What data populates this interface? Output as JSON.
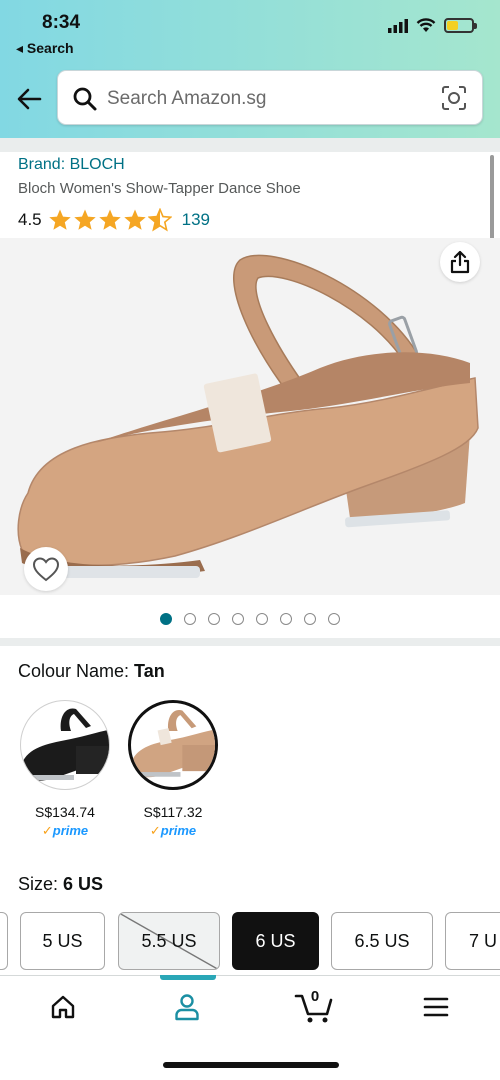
{
  "status_bar": {
    "time": "8:34",
    "back_label": "◂ Search"
  },
  "search": {
    "placeholder": "Search Amazon.sg"
  },
  "product": {
    "brand": "Brand: BLOCH",
    "title": "Bloch Women's Show-Tapper Dance Shoe",
    "rating": "4.5",
    "rating_value": 4.5,
    "review_count": "139"
  },
  "gallery": {
    "image_count": 8,
    "active_index": 0
  },
  "colour": {
    "label": "Colour Name: ",
    "selected": "Tan",
    "options": [
      {
        "name": "Black",
        "price": "S$134.74",
        "prime": "prime",
        "color": "#1b1b1b"
      },
      {
        "name": "Tan",
        "price": "S$117.32",
        "prime": "prime",
        "color": "#c79a78"
      }
    ]
  },
  "size": {
    "label": "Size: ",
    "selected": "6 US",
    "options": [
      "5 US",
      "5.5 US",
      "6 US",
      "6.5 US",
      "7 U"
    ]
  },
  "bottom_nav": {
    "cart_count": "0"
  },
  "colors": {
    "link": "#007185",
    "star": "#f5a623",
    "prime": "#1a98ff",
    "header_start": "#82d8e3",
    "header_end": "#a5e6ce"
  }
}
